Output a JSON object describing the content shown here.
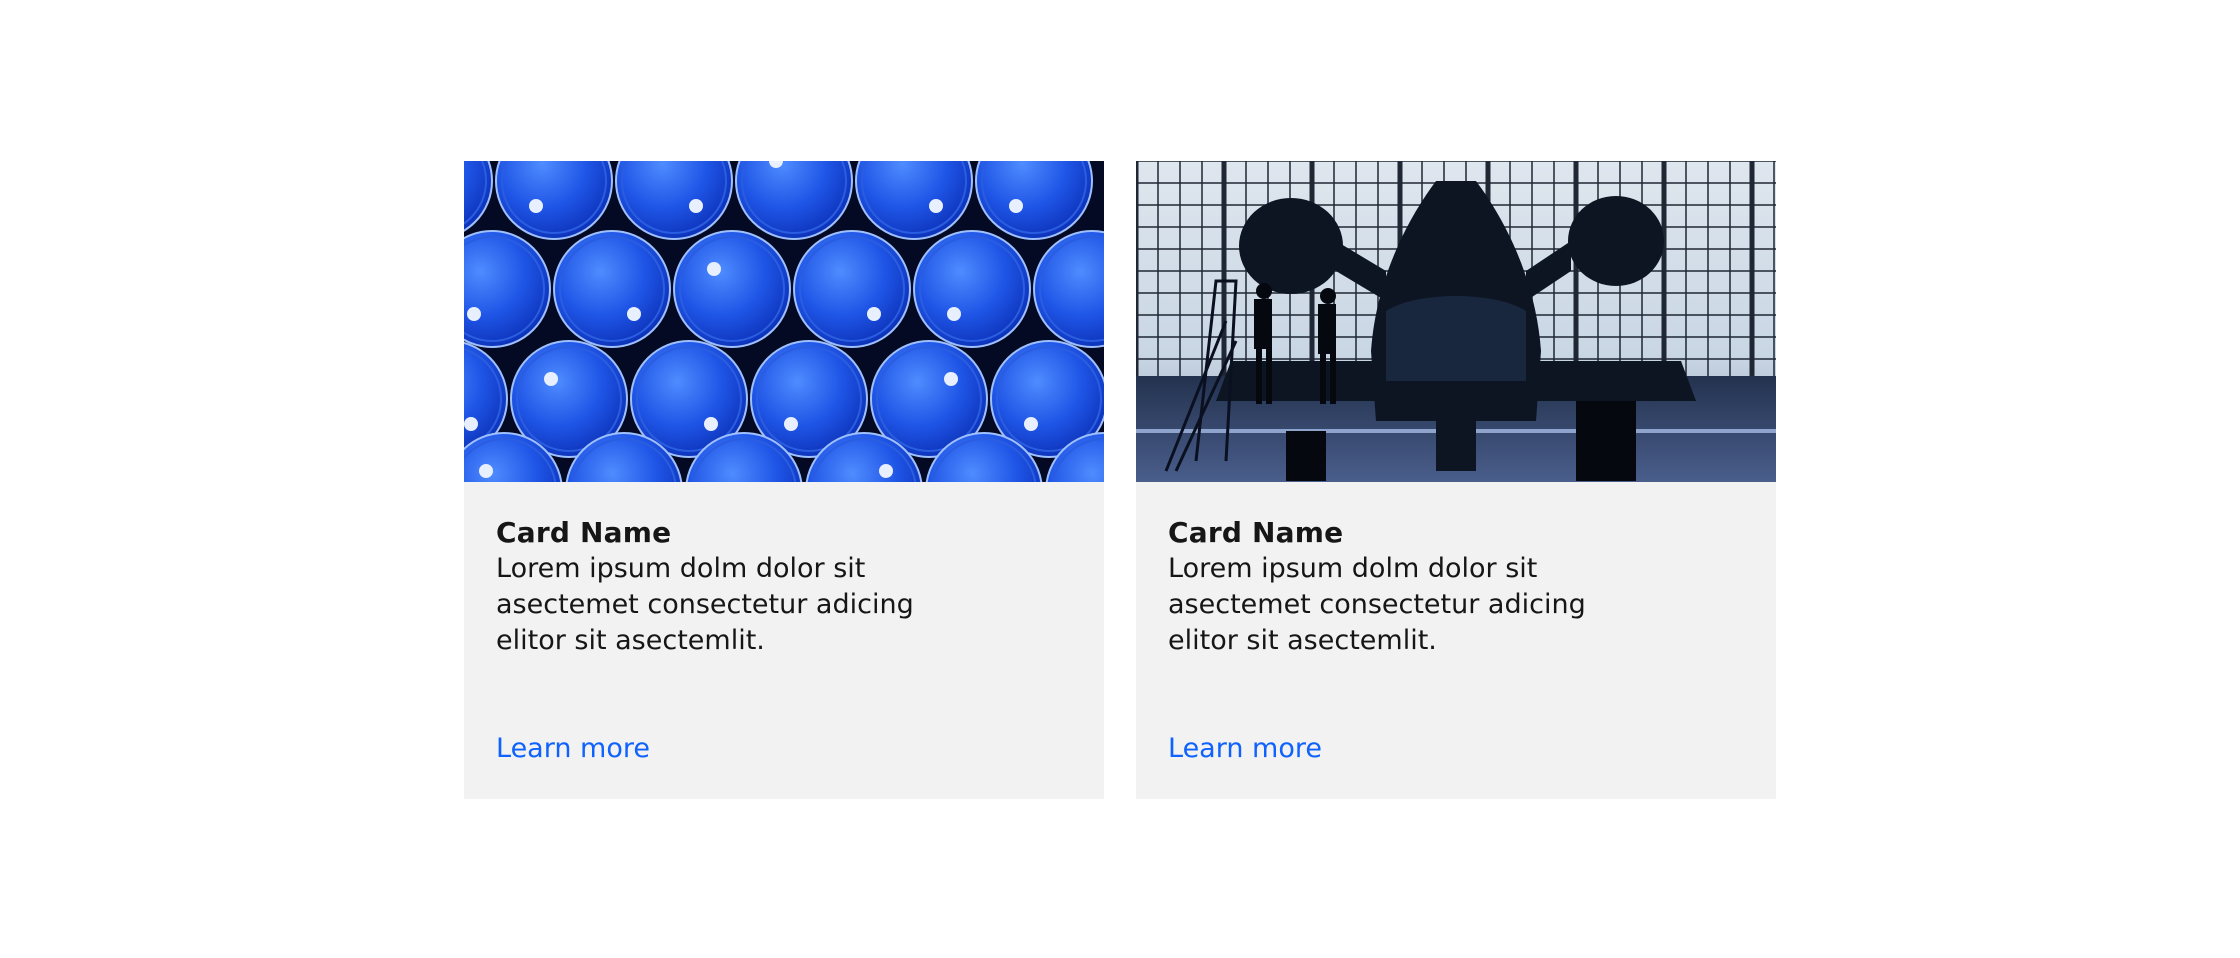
{
  "cards": [
    {
      "title": "Card Name",
      "description": "Lorem ipsum dolm dolor sit asectemet consectetur adicing elitor sit asectemlit.",
      "link_label": "Learn more",
      "image": "blue-barrels-photo"
    },
    {
      "title": "Card Name",
      "description": "Lorem ipsum dolm dolor sit asectemet consectetur adicing elitor sit asectemlit.",
      "link_label": "Learn more",
      "image": "aircraft-hangar-photo"
    }
  ],
  "colors": {
    "card_background": "#f2f2f2",
    "text": "#161616",
    "link": "#0f62fe"
  }
}
